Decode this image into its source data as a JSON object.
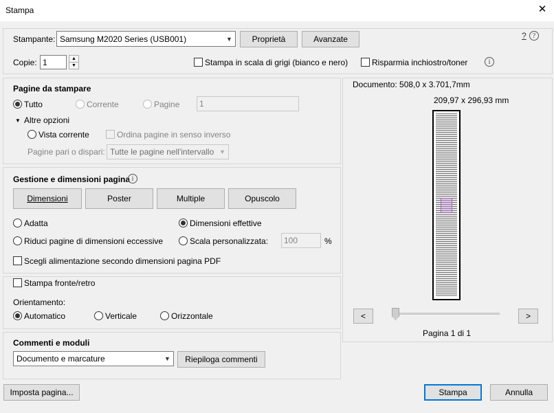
{
  "window": {
    "title": "Stampa"
  },
  "printer": {
    "label": "Stampante:",
    "selected": "Samsung M2020 Series (USB001)",
    "properties_label": "Proprietà",
    "advanced_label": "Avanzate",
    "help_label": "?"
  },
  "copies": {
    "label": "Copie:",
    "value": "1"
  },
  "options": {
    "grayscale_label": "Stampa in scala di grigi (bianco e nero)",
    "save_ink_label": "Risparmia inchiostro/toner"
  },
  "pages": {
    "title": "Pagine da stampare",
    "all_label": "Tutto",
    "current_label": "Corrente",
    "pages_label": "Pagine",
    "pages_value": "1",
    "more_options_label": "Altre opzioni",
    "current_view_label": "Vista corrente",
    "reverse_label": "Ordina pagine in senso inverso",
    "odd_even_label": "Pagine pari o dispari:",
    "odd_even_value": "Tutte le pagine nell'intervallo"
  },
  "sizing": {
    "title": "Gestione e dimensioni pagina",
    "buttons": {
      "size": "Dimensioni",
      "poster": "Poster",
      "multiple": "Multiple",
      "booklet": "Opuscolo"
    },
    "fit_label": "Adatta",
    "actual_label": "Dimensioni effettive",
    "shrink_label": "Riduci pagine di dimensioni eccessive",
    "custom_label": "Scala personalizzata:",
    "custom_value": "100",
    "percent": "%",
    "paper_source_label": "Scegli alimentazione secondo dimensioni pagina PDF"
  },
  "duplex": {
    "label": "Stampa fronte/retro",
    "orientation_label": "Orientamento:",
    "auto_label": "Automatico",
    "portrait_label": "Verticale",
    "landscape_label": "Orizzontale"
  },
  "comments": {
    "title": "Commenti e moduli",
    "selected": "Documento e marcature",
    "summary_label": "Riepiloga commenti"
  },
  "preview": {
    "document_label": "Documento: 508,0 x 3.701,7mm",
    "size_label": "209,97 x 296,93 mm",
    "prev_label": "<",
    "next_label": ">",
    "page_label": "Pagina 1 di 1",
    "page_progress": 0
  },
  "footer": {
    "page_setup_label": "Imposta pagina...",
    "print_label": "Stampa",
    "cancel_label": "Annulla"
  }
}
